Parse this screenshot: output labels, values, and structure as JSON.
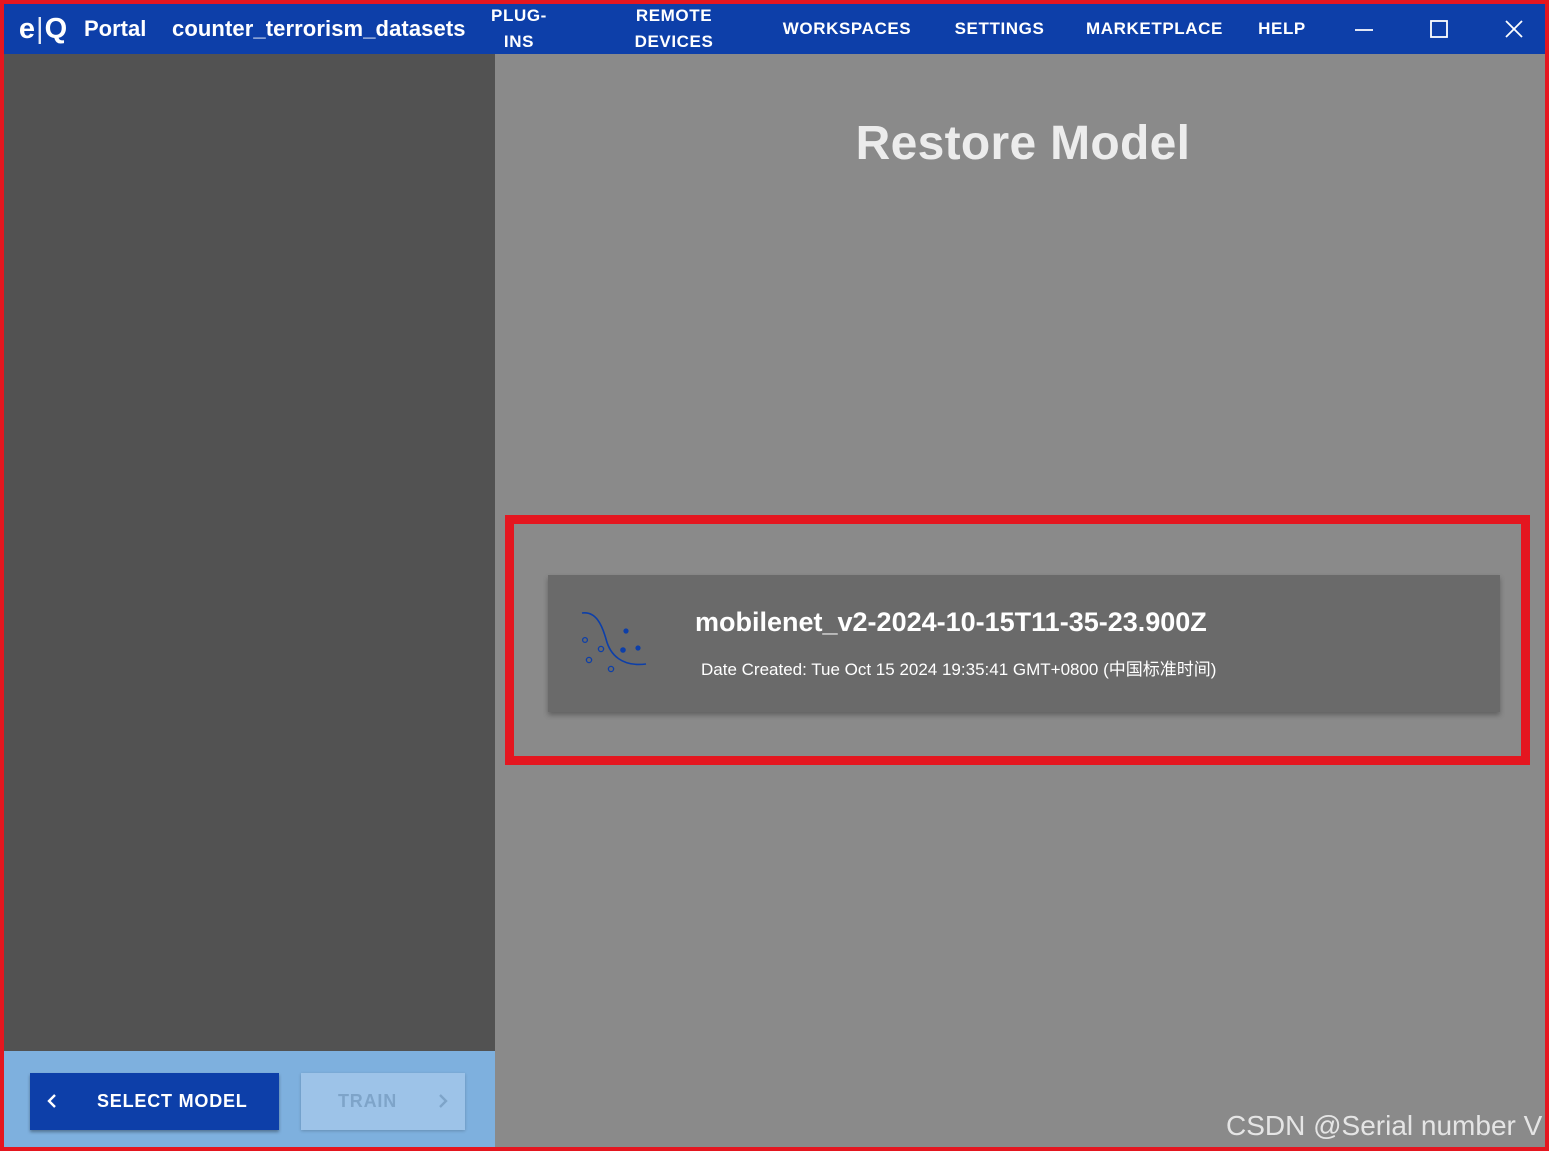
{
  "header": {
    "logo": {
      "left": "e",
      "sep": "|",
      "right": "Q"
    },
    "app_name": "Portal",
    "project_name": "counter_terrorism_datasets",
    "menu": {
      "plugins": [
        "PLUG-",
        "INS"
      ],
      "remote_devices": [
        "REMOTE",
        "DEVICES"
      ],
      "workspaces": "WORKSPACES",
      "settings": "SETTINGS",
      "marketplace": "MARKETPLACE",
      "help": "HELP"
    },
    "window_controls": [
      "minimize-icon",
      "maximize-icon",
      "close-icon"
    ]
  },
  "footer": {
    "back_button": {
      "label": "SELECT MODEL",
      "icon": "chevron-left-icon"
    },
    "next_button": {
      "label": "TRAIN",
      "icon": "chevron-right-icon",
      "disabled": true
    }
  },
  "main": {
    "title": "Restore Model",
    "models": [
      {
        "icon": "model-curve-icon",
        "name": "mobilenet_v2-2024-10-15T11-35-23.900Z",
        "date_created": "Date Created: Tue Oct 15 2024 19:35:41 GMT+0800 (中国标准时间)"
      }
    ]
  },
  "watermark": "CSDN @Serial number V",
  "colors": {
    "header_bg": "#0d3fa9",
    "sidebar_bg": "#525252",
    "main_bg": "#8a8a8a",
    "card_bg": "#6a6a6a",
    "bottom_bar_bg": "#7eb0de",
    "highlight_border": "#e4161f"
  }
}
